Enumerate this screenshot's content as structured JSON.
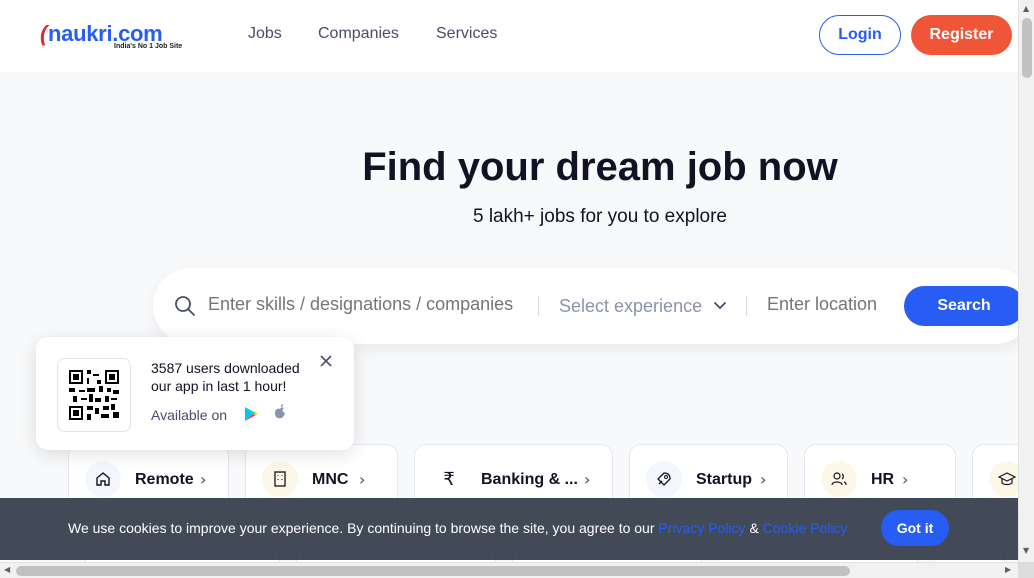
{
  "header": {
    "logo_text": "naukri.com",
    "logo_tagline": "India's No 1 Job Site",
    "nav": [
      "Jobs",
      "Companies",
      "Services"
    ],
    "login_label": "Login",
    "register_label": "Register"
  },
  "hero": {
    "title": "Find your dream job now",
    "subtitle": "5 lakh+ jobs for you to explore"
  },
  "search": {
    "skills_placeholder": "Enter skills / designations / companies",
    "experience_placeholder": "Select experience",
    "location_placeholder": "Enter location",
    "button_label": "Search"
  },
  "app_popup": {
    "line1": "3587 users downloaded",
    "line2": "our app in last 1 hour!",
    "available_label": "Available on"
  },
  "categories": [
    {
      "label": "Remote",
      "icon": "home-icon"
    },
    {
      "label": "MNC",
      "icon": "building-icon"
    },
    {
      "label": "Banking & ...",
      "icon": "rupee-icon"
    },
    {
      "label": "Startup",
      "icon": "rocket-icon"
    },
    {
      "label": "HR",
      "icon": "people-icon"
    },
    {
      "label": "",
      "icon": "graduation-cap-icon"
    }
  ],
  "cookie": {
    "text": "We use cookies to improve your experience. By continuing to browse the site, you agree to our",
    "privacy_link": "Privacy Policy",
    "amp": "&",
    "cookie_link": "Cookie Policy",
    "button_label": "Got it"
  },
  "colors": {
    "brand_blue": "#275df5",
    "register_orange": "#f05537",
    "cookie_bg": "#283140"
  }
}
